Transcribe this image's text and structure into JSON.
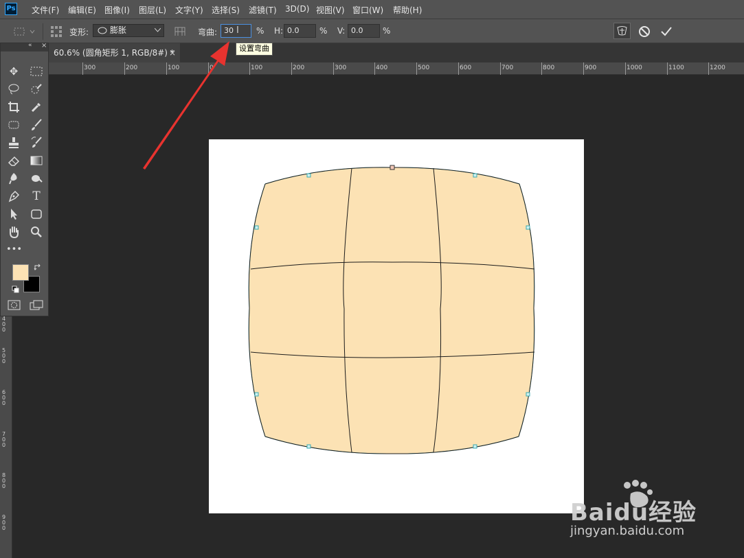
{
  "app": {
    "logo_text": "Ps"
  },
  "menu": [
    {
      "label": "文件(F)"
    },
    {
      "label": "编辑(E)"
    },
    {
      "label": "图像(I)"
    },
    {
      "label": "图层(L)"
    },
    {
      "label": "文字(Y)"
    },
    {
      "label": "选择(S)"
    },
    {
      "label": "滤镜(T)"
    },
    {
      "label": "3D(D)"
    },
    {
      "label": "视图(V)"
    },
    {
      "label": "窗口(W)"
    },
    {
      "label": "帮助(H)"
    }
  ],
  "options": {
    "transform_label": "变形:",
    "warp_style": "膨胀",
    "bend_label": "弯曲:",
    "bend_value": "30",
    "bend_unit": "%",
    "h_label": "H:",
    "h_value": "0.0",
    "h_unit": "%",
    "v_label": "V:",
    "v_value": "0.0",
    "v_unit": "%"
  },
  "tooltip": {
    "text": "设置弯曲"
  },
  "document_tab": {
    "title": "60.6% (圆角矩形 1, RGB/8#) *",
    "close": "×"
  },
  "ruler": {
    "h_labels": [
      "300",
      "200",
      "100",
      "0",
      "100",
      "200",
      "300",
      "400",
      "500",
      "600",
      "700",
      "800",
      "900",
      "1000",
      "1100",
      "1200"
    ],
    "v_labels": [
      "400",
      "500",
      "600",
      "700",
      "800",
      "900"
    ]
  },
  "colors": {
    "foreground": "#fce2b4",
    "background": "#000000",
    "shape_fill": "#fce2b4",
    "accent_arrow": "#e8332f"
  },
  "watermark": {
    "brand": "Baidu经验",
    "url": "jingyan.baidu.com"
  }
}
